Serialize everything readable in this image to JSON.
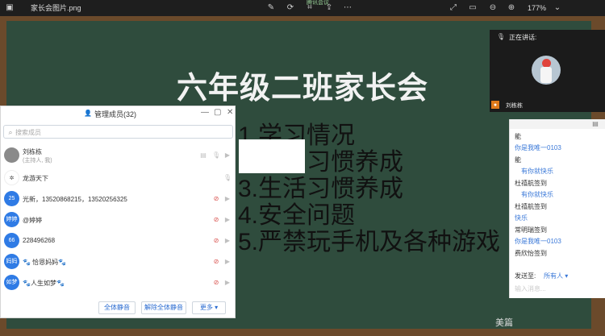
{
  "viewer": {
    "filename": "家长会图片.png",
    "zoom": "177%",
    "meeting_app_label": "腾讯会议"
  },
  "slide": {
    "title": "六年级二班家长会",
    "items": [
      "1.学习情况",
      "2.学习习惯养成",
      "3.生活习惯养成",
      "4.安全问题",
      "5.严禁玩手机及各种游戏"
    ]
  },
  "speaker": {
    "label": "正在讲话:",
    "name": "刘栋栋"
  },
  "members": {
    "title": "管理成员(32)",
    "search_placeholder": "搜索成员",
    "list": [
      {
        "avatar": "",
        "avatar_color": "#8a8a8a",
        "name": "刘栋栋",
        "sub": "(主持人, 我)"
      },
      {
        "avatar": "",
        "avatar_color": "#ffffff",
        "name": "龙游天下",
        "sub": ""
      },
      {
        "avatar": "25",
        "avatar_color": "#2f7be5",
        "name": "光新，13520868215，13520256325",
        "sub": ""
      },
      {
        "avatar": "婷婷",
        "avatar_color": "#2f7be5",
        "name": "@婷婷",
        "sub": ""
      },
      {
        "avatar": "66",
        "avatar_color": "#2f7be5",
        "name": "228496268",
        "sub": ""
      },
      {
        "avatar": "妈妈",
        "avatar_color": "#2f7be5",
        "name": "🐾 恰恩妈妈🐾",
        "sub": ""
      },
      {
        "avatar": "如梦",
        "avatar_color": "#2f7be5",
        "name": "🐾人生如梦🐾",
        "sub": ""
      }
    ],
    "buttons": {
      "mute_all": "全体静音",
      "unmute_all": "解除全体静音",
      "more": "更多 ▾"
    }
  },
  "chat": {
    "lines": [
      {
        "text": "能",
        "style": "blk"
      },
      {
        "text": "你是我唯一0103",
        "style": "blu"
      },
      {
        "text": "能",
        "style": "blk"
      },
      {
        "text": "有你就快乐",
        "style": "blu-ind"
      },
      {
        "text": "杜禧航签到",
        "style": "blk"
      },
      {
        "text": "有你就快乐",
        "style": "blu-ind"
      },
      {
        "text": "杜禧航签到",
        "style": "blk"
      },
      {
        "text": "快乐",
        "style": "blu"
      },
      {
        "text": "常明瑞签到",
        "style": "blk"
      },
      {
        "text": "你是我唯一0103",
        "style": "blu"
      },
      {
        "text": "费欣怡签到",
        "style": "blk"
      }
    ],
    "send_to_label": "发送至:",
    "send_to_value": "所有人 ▾",
    "input_placeholder": "输入消息..."
  },
  "watermark": "美篇"
}
